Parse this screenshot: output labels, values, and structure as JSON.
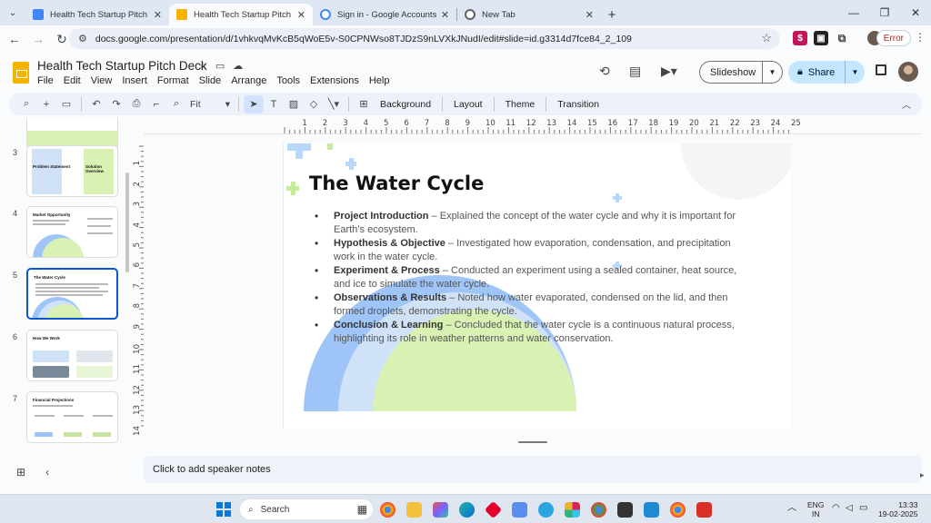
{
  "browser": {
    "tabs": [
      {
        "title": "Health Tech Startup Pitch Deck",
        "favicon_color": "#4285f4",
        "active": false
      },
      {
        "title": "Health Tech Startup Pitch Deck",
        "favicon_color": "#f4b400",
        "active": true
      },
      {
        "title": "Sign in - Google Accounts",
        "favicon_color": "#4285f4",
        "active": false
      },
      {
        "title": "New Tab",
        "favicon_color": "#5f6368",
        "active": false
      }
    ],
    "url": "docs.google.com/presentation/d/1vhkvqMvKcB5qWoE5v-S0CPNWso8TJDzS9nLVXkJNudI/edit#slide=id.g3314d7fce84_2_109",
    "error_label": "Error"
  },
  "doc": {
    "title": "Health Tech Startup Pitch Deck",
    "menu": [
      "File",
      "Edit",
      "View",
      "Insert",
      "Format",
      "Slide",
      "Arrange",
      "Tools",
      "Extensions",
      "Help"
    ],
    "slideshow_label": "Slideshow",
    "share_label": "Share"
  },
  "toolbar": {
    "zoom": "Fit",
    "background": "Background",
    "layout": "Layout",
    "theme": "Theme",
    "transition": "Transition"
  },
  "filmstrip": {
    "slides": [
      {
        "number": "3",
        "title": "Problem Statement",
        "title2": "Solution Overview"
      },
      {
        "number": "4",
        "title": "Market Opportunity"
      },
      {
        "number": "5",
        "title": "The Water Cycle",
        "selected": true
      },
      {
        "number": "6",
        "title": "How We Work"
      },
      {
        "number": "7",
        "title": "Financial Projections"
      }
    ]
  },
  "rulers": {
    "horizontal": [
      "1",
      "2",
      "3",
      "4",
      "5",
      "6",
      "7",
      "8",
      "9",
      "10",
      "11",
      "12",
      "13",
      "14",
      "15",
      "16",
      "17",
      "18",
      "19",
      "20",
      "21",
      "22",
      "23",
      "24",
      "25"
    ],
    "vertical": [
      "1",
      "2",
      "3",
      "4",
      "5",
      "6",
      "7",
      "8",
      "9",
      "10",
      "11",
      "12",
      "13",
      "14"
    ]
  },
  "slide": {
    "title": "The Water Cycle",
    "bullets": [
      {
        "head": "Project Introduction",
        "text": " – Explained the concept of the water cycle and why it is important for Earth’s ecosystem."
      },
      {
        "head": "Hypothesis & Objective",
        "text": " – Investigated how evaporation, condensation, and precipitation work in the water cycle."
      },
      {
        "head": "Experiment & Process",
        "text": " – Conducted an experiment using a sealed container, heat source, and ice to simulate the water cycle."
      },
      {
        "head": "Observations & Results",
        "text": " – Noted how water evaporated, condensed on the lid, and then formed droplets, demonstrating the cycle."
      },
      {
        "head": "Conclusion & Learning",
        "text": " – Concluded that the water cycle is a continuous natural process, highlighting its role in weather patterns and water conservation."
      }
    ],
    "colors": {
      "blue": "#9fc5f8",
      "light_blue": "#cfe2f7",
      "green": "#d9f2b4",
      "plus_green": "#c5ec9a",
      "plus_blue": "#b9d7f7"
    }
  },
  "notes_placeholder": "Click to add speaker notes",
  "taskbar": {
    "search_placeholder": "Search",
    "lang_top": "ENG",
    "lang_bottom": "IN",
    "time": "13:33",
    "date": "19-02-2025"
  }
}
